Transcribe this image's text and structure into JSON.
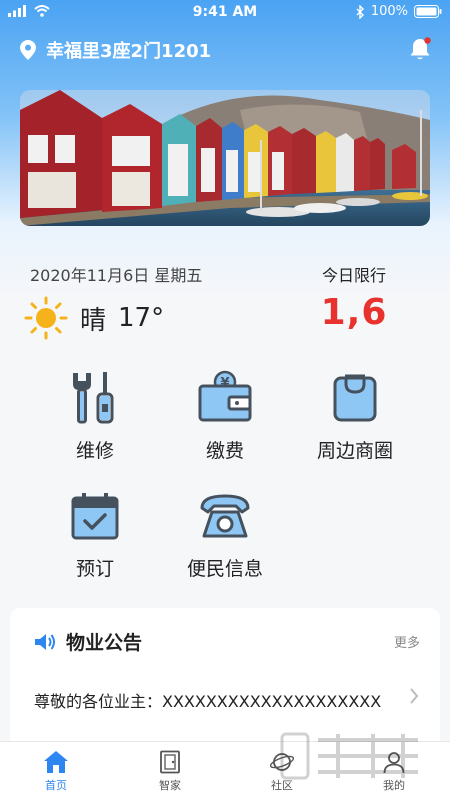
{
  "status_bar": {
    "time": "9:41 AM",
    "battery": "100%"
  },
  "header": {
    "address": "幸福里3座2门1201"
  },
  "info": {
    "date": "2020年11月6日 星期五",
    "weather": "晴",
    "temperature": "17°",
    "limit_title": "今日限行",
    "limit_value": "1,6"
  },
  "services": [
    {
      "label": "维修",
      "icon": "repair-icon"
    },
    {
      "label": "缴费",
      "icon": "payment-icon"
    },
    {
      "label": "周边商圈",
      "icon": "shopping-bag-icon"
    },
    {
      "label": "预订",
      "icon": "calendar-icon"
    },
    {
      "label": "便民信息",
      "icon": "telephone-icon"
    }
  ],
  "notice": {
    "title": "物业公告",
    "more": "更多",
    "item": "尊敬的各位业主：XXXXXXXXXXXXXXXXXXXX"
  },
  "tabbar": {
    "items": [
      {
        "label": "首页",
        "icon": "home-icon",
        "active": true
      },
      {
        "label": "智家",
        "icon": "door-icon",
        "active": false
      },
      {
        "label": "社区",
        "icon": "planet-icon",
        "active": false
      },
      {
        "label": "我的",
        "icon": "user-icon",
        "active": false
      }
    ]
  },
  "colors": {
    "accent": "#2e86f0",
    "limit": "#e8322e",
    "sun": "#f5b21b"
  }
}
